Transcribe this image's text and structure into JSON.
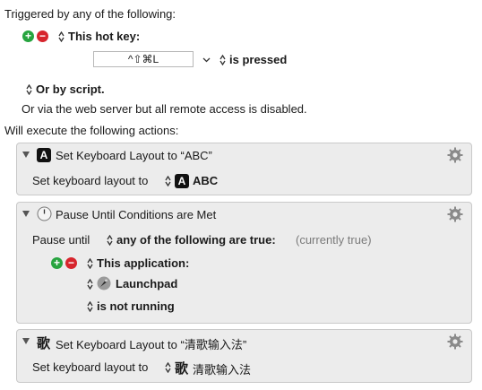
{
  "trigger": {
    "heading": "Triggered by any of the following:",
    "hotkey_label": "This hot key:",
    "hotkey_value": "^⇧⌘L",
    "hotkey_condition": "is pressed",
    "script_label": "Or by script.",
    "web_server_note": "Or via the web server but all remote access is disabled."
  },
  "actions": {
    "heading": "Will execute the following actions:",
    "items": [
      {
        "title": "Set Keyboard Layout to “ABC”",
        "icon": "A",
        "body_label": "Set keyboard layout to",
        "layout_icon": "A",
        "layout_value": "ABC"
      },
      {
        "title": "Pause Until Conditions are Met",
        "pause_label": "Pause until",
        "condition_mode": "any of the following are true:",
        "status": "(currently true)",
        "condition_label": "This application:",
        "app_name": "Launchpad",
        "app_state": "is not running"
      },
      {
        "title": "Set Keyboard Layout to “清歌输入法”",
        "icon": "歌",
        "body_label": "Set keyboard layout to",
        "layout_icon": "歌",
        "layout_value": "清歌输入法"
      }
    ]
  }
}
